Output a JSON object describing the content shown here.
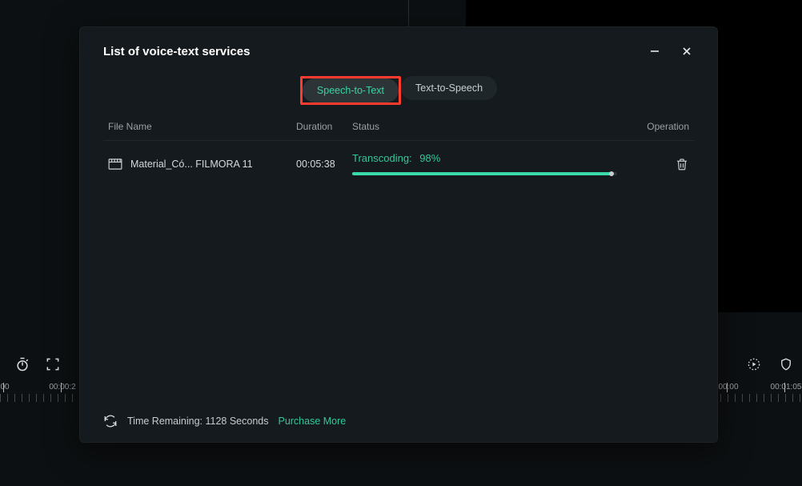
{
  "modal": {
    "title": "List of voice-text services",
    "tabs": {
      "active": "Speech-to-Text",
      "inactive": "Text-to-Speech"
    },
    "columns": {
      "file": "File Name",
      "duration": "Duration",
      "status": "Status",
      "operation": "Operation"
    },
    "row": {
      "filename": "Material_Có... FILMORA 11",
      "duration": "00:05:38",
      "status_label": "Transcoding:",
      "status_pct": "98%",
      "progress_pct": 98
    },
    "footer": {
      "time_remaining": "Time Remaining: 1128 Seconds",
      "purchase": "Purchase More"
    }
  },
  "timeline": {
    "t0": "00",
    "t1": "00:00:2",
    "t2": "00:00",
    "t3": "00:01:05"
  }
}
